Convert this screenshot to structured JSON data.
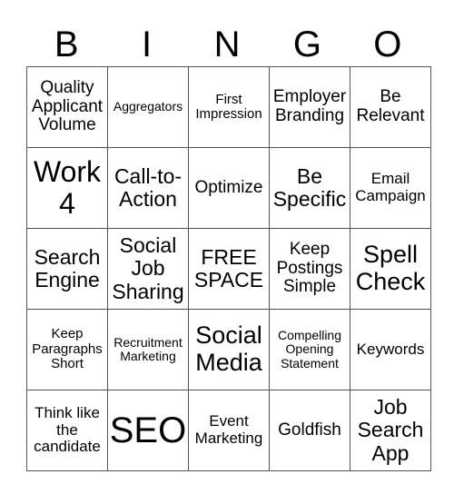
{
  "header": [
    "B",
    "I",
    "N",
    "G",
    "O"
  ],
  "rows": [
    [
      "Quality Applicant Volume",
      "Aggregators",
      "First Impression",
      "Employer Branding",
      "Be Relevant"
    ],
    [
      "Work 4",
      "Call-to-Action",
      "Optimize",
      "Be Specific",
      "Email Campaign"
    ],
    [
      "Search Engine",
      "Social Job Sharing",
      "FREE SPACE",
      "Keep Postings Simple",
      "Spell Check"
    ],
    [
      "Keep Paragraphs Short",
      "Recruitment Marketing",
      "Social Media",
      "Compelling Opening Statement",
      "Keywords"
    ],
    [
      "Think like the candidate",
      "SEO",
      "Event Marketing",
      "Goldfish",
      "Job Search App"
    ]
  ]
}
